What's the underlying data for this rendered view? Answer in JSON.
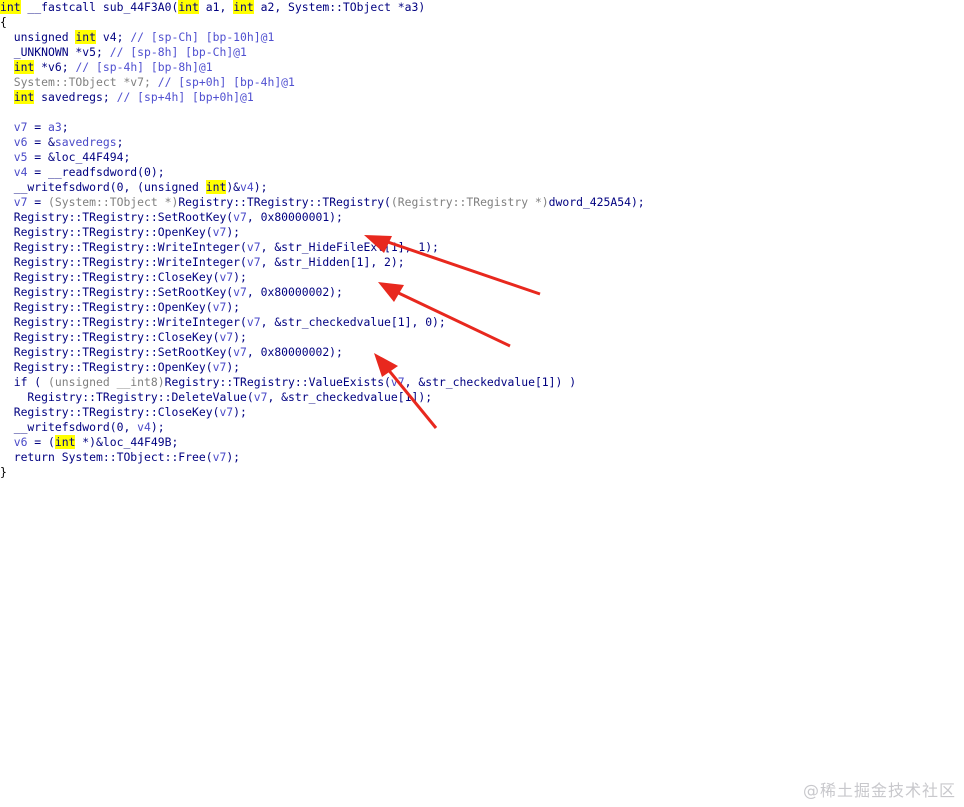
{
  "colors": {
    "background": "#ffffff",
    "code_text": "#000080",
    "keyword_highlight": "#ffff00",
    "comment": "#5050d0",
    "variable": "#4a4ac8",
    "cast_grey": "#808080",
    "arrow": "#e8281e"
  },
  "code_lines": [
    [
      [
        "int",
        "kw"
      ],
      [
        " __fastcall sub_44F3A0(",
        "plain"
      ],
      [
        "int",
        "kw"
      ],
      [
        " a1, ",
        "plain"
      ],
      [
        "int",
        "kw"
      ],
      [
        " a2, System::TObject *a3)",
        "plain"
      ]
    ],
    [
      [
        "{",
        "black"
      ]
    ],
    [
      [
        "  unsigned ",
        "plain"
      ],
      [
        "int",
        "kw"
      ],
      [
        " v4; ",
        "plain"
      ],
      [
        "// [sp-Ch] [bp-10h]@1",
        "cmt"
      ]
    ],
    [
      [
        "  _UNKNOWN *v5; ",
        "plain"
      ],
      [
        "// [sp-8h] [bp-Ch]@1",
        "cmt"
      ]
    ],
    [
      [
        "  ",
        "plain"
      ],
      [
        "int",
        "kw"
      ],
      [
        " *v6; ",
        "plain"
      ],
      [
        "// [sp-4h] [bp-8h]@1",
        "cmt"
      ]
    ],
    [
      [
        "  System::TObject *v7; ",
        "grey"
      ],
      [
        "// [sp+0h] [bp-4h]@1",
        "cmt"
      ]
    ],
    [
      [
        "  ",
        "plain"
      ],
      [
        "int",
        "kw"
      ],
      [
        " savedregs; ",
        "plain"
      ],
      [
        "// [sp+4h] [bp+0h]@1",
        "cmt"
      ]
    ],
    [
      [
        "",
        "plain"
      ]
    ],
    [
      [
        "  v7",
        "var"
      ],
      [
        " = ",
        "plain"
      ],
      [
        "a3",
        "var"
      ],
      [
        ";",
        "plain"
      ]
    ],
    [
      [
        "  v6",
        "var"
      ],
      [
        " = &",
        "plain"
      ],
      [
        "savedregs",
        "var"
      ],
      [
        ";",
        "plain"
      ]
    ],
    [
      [
        "  v5",
        "var"
      ],
      [
        " = &loc_44F494;",
        "plain"
      ]
    ],
    [
      [
        "  v4",
        "var"
      ],
      [
        " = __readfsdword(0);",
        "plain"
      ]
    ],
    [
      [
        "  __writefsdword(0, (unsigned ",
        "plain"
      ],
      [
        "int",
        "kw"
      ],
      [
        ")&",
        "plain"
      ],
      [
        "v4",
        "var"
      ],
      [
        ");",
        "plain"
      ]
    ],
    [
      [
        "  v7",
        "var"
      ],
      [
        " = ",
        "plain"
      ],
      [
        "(System::TObject *)",
        "grey"
      ],
      [
        "Registry::TRegistry::TRegistry(",
        "plain"
      ],
      [
        "(Registry::TRegistry *)",
        "grey"
      ],
      [
        "dword_425A54);",
        "plain"
      ]
    ],
    [
      [
        "  Registry::TRegistry::SetRootKey(",
        "plain"
      ],
      [
        "v7",
        "var"
      ],
      [
        ", 0x80000001);",
        "plain"
      ]
    ],
    [
      [
        "  Registry::TRegistry::OpenKey(",
        "plain"
      ],
      [
        "v7",
        "var"
      ],
      [
        ");",
        "plain"
      ]
    ],
    [
      [
        "  Registry::TRegistry::WriteInteger(",
        "plain"
      ],
      [
        "v7",
        "var"
      ],
      [
        ", &str_HideFileExt[1], 1);",
        "plain"
      ]
    ],
    [
      [
        "  Registry::TRegistry::WriteInteger(",
        "plain"
      ],
      [
        "v7",
        "var"
      ],
      [
        ", &str_Hidden[1], 2);",
        "plain"
      ]
    ],
    [
      [
        "  Registry::TRegistry::CloseKey(",
        "plain"
      ],
      [
        "v7",
        "var"
      ],
      [
        ");",
        "plain"
      ]
    ],
    [
      [
        "  Registry::TRegistry::SetRootKey(",
        "plain"
      ],
      [
        "v7",
        "var"
      ],
      [
        ", 0x80000002);",
        "plain"
      ]
    ],
    [
      [
        "  Registry::TRegistry::OpenKey(",
        "plain"
      ],
      [
        "v7",
        "var"
      ],
      [
        ");",
        "plain"
      ]
    ],
    [
      [
        "  Registry::TRegistry::WriteInteger(",
        "plain"
      ],
      [
        "v7",
        "var"
      ],
      [
        ", &str_checkedvalue[1], 0);",
        "plain"
      ]
    ],
    [
      [
        "  Registry::TRegistry::CloseKey(",
        "plain"
      ],
      [
        "v7",
        "var"
      ],
      [
        ");",
        "plain"
      ]
    ],
    [
      [
        "  Registry::TRegistry::SetRootKey(",
        "plain"
      ],
      [
        "v7",
        "var"
      ],
      [
        ", 0x80000002);",
        "plain"
      ]
    ],
    [
      [
        "  Registry::TRegistry::OpenKey(",
        "plain"
      ],
      [
        "v7",
        "var"
      ],
      [
        ");",
        "plain"
      ]
    ],
    [
      [
        "  if ( ",
        "plain"
      ],
      [
        "(unsigned __int8)",
        "grey"
      ],
      [
        "Registry::TRegistry::ValueExists(",
        "plain"
      ],
      [
        "v7",
        "var"
      ],
      [
        ", &str_checkedvalue[1]) )",
        "plain"
      ]
    ],
    [
      [
        "    Registry::TRegistry::DeleteValue(",
        "plain"
      ],
      [
        "v7",
        "var"
      ],
      [
        ", &str_checkedvalue[1]);",
        "plain"
      ]
    ],
    [
      [
        "  Registry::TRegistry::CloseKey(",
        "plain"
      ],
      [
        "v7",
        "var"
      ],
      [
        ");",
        "plain"
      ]
    ],
    [
      [
        "  __writefsdword(0, ",
        "plain"
      ],
      [
        "v4",
        "var"
      ],
      [
        ");",
        "plain"
      ]
    ],
    [
      [
        "  v6",
        "var"
      ],
      [
        " = (",
        "plain"
      ],
      [
        "int",
        "kw"
      ],
      [
        " *)&loc_44F49B;",
        "plain"
      ]
    ],
    [
      [
        "  return System::TObject::Free(",
        "plain"
      ],
      [
        "v7",
        "var"
      ],
      [
        ");",
        "plain"
      ]
    ],
    [
      [
        "}",
        "black"
      ]
    ]
  ],
  "watermark": "@稀土掘金技术社区"
}
